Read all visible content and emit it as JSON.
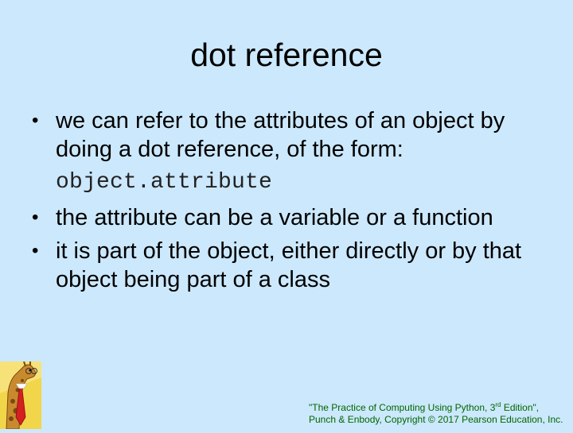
{
  "slide": {
    "title": "dot reference",
    "bullets": [
      {
        "text": "we can refer to the attributes of an object by doing a dot reference, of the form:",
        "code": "object.attribute"
      },
      {
        "text": "the attribute can be a variable or a function"
      },
      {
        "text": "it is part of the object, either directly or by that object being part of a class"
      }
    ],
    "bullet_char": "•",
    "footer": {
      "line1_pre": "\"The Practice of Computing Using Python, 3",
      "line1_sup": "rd",
      "line1_post": " Edition\",",
      "line2": "Punch & Enbody, Copyright © 2017 Pearson Education, Inc."
    }
  },
  "colors": {
    "background": "#cce8fc",
    "footer_text": "#006600"
  },
  "icons": {
    "logo": "giraffe-logo-icon"
  }
}
